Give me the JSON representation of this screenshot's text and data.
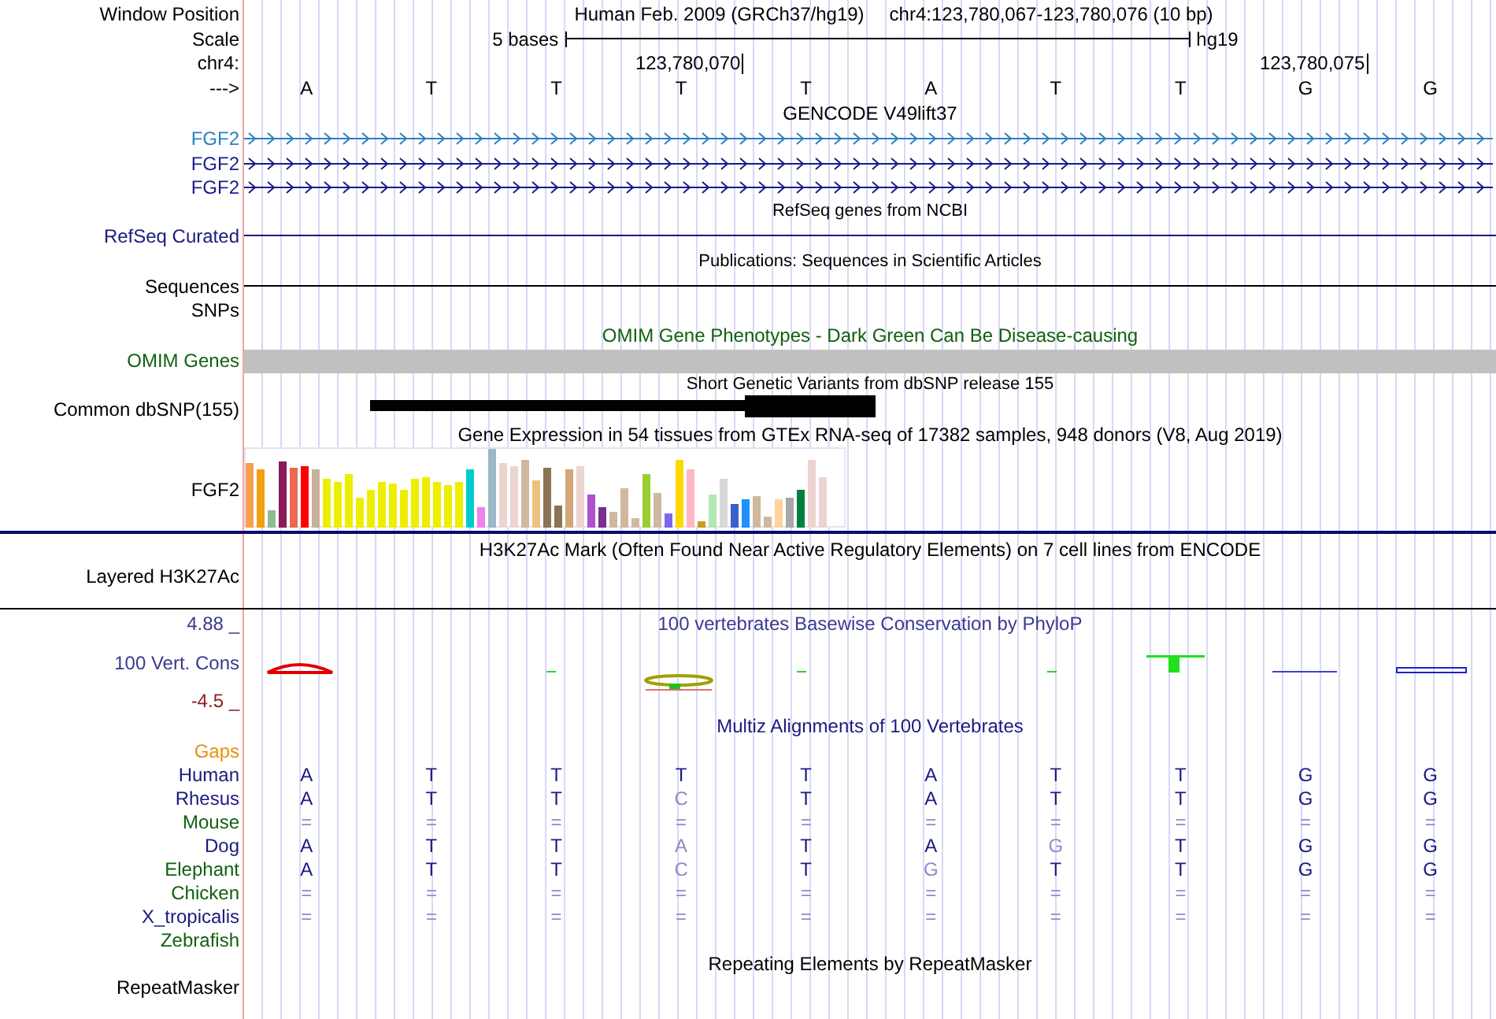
{
  "header": {
    "label": "Window Position",
    "assembly_title": "Human Feb. 2009 (GRCh37/hg19)",
    "position": "chr4:123,780,067-123,780,076 (10 bp)"
  },
  "scale": {
    "label": "Scale",
    "span": "5 bases",
    "assembly": "hg19"
  },
  "coordinates": {
    "label": "chr4:",
    "ticks": [
      "123,780,070",
      "123,780,075"
    ]
  },
  "sequence": {
    "label": "--->",
    "bases": [
      "A",
      "T",
      "T",
      "T",
      "T",
      "A",
      "T",
      "T",
      "G",
      "G"
    ]
  },
  "gencode": {
    "title": "GENCODE V49lift37",
    "genes": [
      {
        "label": "FGF2",
        "color": "#2a7fc0"
      },
      {
        "label": "FGF2",
        "color": "#1a1a8c"
      },
      {
        "label": "FGF2",
        "color": "#1a1a8c"
      }
    ]
  },
  "refseq": {
    "title": "RefSeq genes from NCBI",
    "label": "RefSeq Curated"
  },
  "publications": {
    "title": "Publications: Sequences in Scientific Articles",
    "labels": [
      "Sequences",
      "SNPs"
    ]
  },
  "omim": {
    "title": "OMIM Gene Phenotypes - Dark Green Can Be Disease-causing",
    "label": "OMIM Genes"
  },
  "dbsnp": {
    "title": "Short Genetic Variants from dbSNP release 155",
    "label": "Common dbSNP(155)"
  },
  "gtex": {
    "title": "Gene Expression in 54 tissues from GTEx RNA-seq of 17382 samples, 948 donors (V8, Aug 2019)",
    "label": "FGF2"
  },
  "h3k27ac": {
    "title": "H3K27Ac Mark (Often Found Near Active Regulatory Elements) on 7 cell lines from ENCODE",
    "label": "Layered H3K27Ac"
  },
  "phylop": {
    "title": "100 vertebrates Basewise Conservation by PhyloP",
    "max": "4.88 _",
    "label": "100 Vert. Cons",
    "min": "-4.5 _"
  },
  "multiz": {
    "title": "Multiz Alignments of 100 Vertebrates",
    "gaps_label": "Gaps",
    "species": [
      {
        "name": "Human",
        "color": "#1a1a80",
        "bases": [
          {
            "base": "A",
            "dimmed": false
          },
          {
            "base": "T",
            "dimmed": false
          },
          {
            "base": "T",
            "dimmed": false
          },
          {
            "base": "T",
            "dimmed": false
          },
          {
            "base": "T",
            "dimmed": false
          },
          {
            "base": "A",
            "dimmed": false
          },
          {
            "base": "T",
            "dimmed": false
          },
          {
            "base": "T",
            "dimmed": false
          },
          {
            "base": "G",
            "dimmed": false
          },
          {
            "base": "G",
            "dimmed": false
          }
        ]
      },
      {
        "name": "Rhesus",
        "color": "#1a1a80",
        "bases": [
          {
            "base": "A",
            "dimmed": false
          },
          {
            "base": "T",
            "dimmed": false
          },
          {
            "base": "T",
            "dimmed": false
          },
          {
            "base": "C",
            "dimmed": true
          },
          {
            "base": "T",
            "dimmed": false
          },
          {
            "base": "A",
            "dimmed": false
          },
          {
            "base": "T",
            "dimmed": false
          },
          {
            "base": "T",
            "dimmed": false
          },
          {
            "base": "G",
            "dimmed": false
          },
          {
            "base": "G",
            "dimmed": false
          }
        ]
      },
      {
        "name": "Mouse",
        "color": "#106010",
        "bases": [
          {
            "base": "=",
            "dimmed": true
          },
          {
            "base": "=",
            "dimmed": true
          },
          {
            "base": "=",
            "dimmed": true
          },
          {
            "base": "=",
            "dimmed": true
          },
          {
            "base": "=",
            "dimmed": true
          },
          {
            "base": "=",
            "dimmed": true
          },
          {
            "base": "=",
            "dimmed": true
          },
          {
            "base": "=",
            "dimmed": true
          },
          {
            "base": "=",
            "dimmed": true
          },
          {
            "base": "=",
            "dimmed": true
          }
        ]
      },
      {
        "name": "Dog",
        "color": "#1a1a80",
        "bases": [
          {
            "base": "A",
            "dimmed": false
          },
          {
            "base": "T",
            "dimmed": false
          },
          {
            "base": "T",
            "dimmed": false
          },
          {
            "base": "A",
            "dimmed": true
          },
          {
            "base": "T",
            "dimmed": false
          },
          {
            "base": "A",
            "dimmed": false
          },
          {
            "base": "G",
            "dimmed": true
          },
          {
            "base": "T",
            "dimmed": false
          },
          {
            "base": "G",
            "dimmed": false
          },
          {
            "base": "G",
            "dimmed": false
          }
        ]
      },
      {
        "name": "Elephant",
        "color": "#106010",
        "bases": [
          {
            "base": "A",
            "dimmed": false
          },
          {
            "base": "T",
            "dimmed": false
          },
          {
            "base": "T",
            "dimmed": false
          },
          {
            "base": "C",
            "dimmed": true
          },
          {
            "base": "T",
            "dimmed": false
          },
          {
            "base": "G",
            "dimmed": true
          },
          {
            "base": "T",
            "dimmed": false
          },
          {
            "base": "T",
            "dimmed": false
          },
          {
            "base": "G",
            "dimmed": false
          },
          {
            "base": "G",
            "dimmed": false
          }
        ]
      },
      {
        "name": "Chicken",
        "color": "#106010",
        "bases": [
          {
            "base": "=",
            "dimmed": true
          },
          {
            "base": "=",
            "dimmed": true
          },
          {
            "base": "=",
            "dimmed": true
          },
          {
            "base": "=",
            "dimmed": true
          },
          {
            "base": "=",
            "dimmed": true
          },
          {
            "base": "=",
            "dimmed": true
          },
          {
            "base": "=",
            "dimmed": true
          },
          {
            "base": "=",
            "dimmed": true
          },
          {
            "base": "=",
            "dimmed": true
          },
          {
            "base": "=",
            "dimmed": true
          }
        ]
      },
      {
        "name": "X_tropicalis",
        "color": "#1a1a80",
        "bases": [
          {
            "base": "=",
            "dimmed": true
          },
          {
            "base": "=",
            "dimmed": true
          },
          {
            "base": "=",
            "dimmed": true
          },
          {
            "base": "=",
            "dimmed": true
          },
          {
            "base": "=",
            "dimmed": true
          },
          {
            "base": "=",
            "dimmed": true
          },
          {
            "base": "=",
            "dimmed": true
          },
          {
            "base": "=",
            "dimmed": true
          },
          {
            "base": "=",
            "dimmed": true
          },
          {
            "base": "=",
            "dimmed": true
          }
        ]
      },
      {
        "name": "Zebrafish",
        "color": "#106010"
      }
    ]
  },
  "repeatmasker": {
    "title": "Repeating Elements by RepeatMasker",
    "label": "RepeatMasker"
  }
}
